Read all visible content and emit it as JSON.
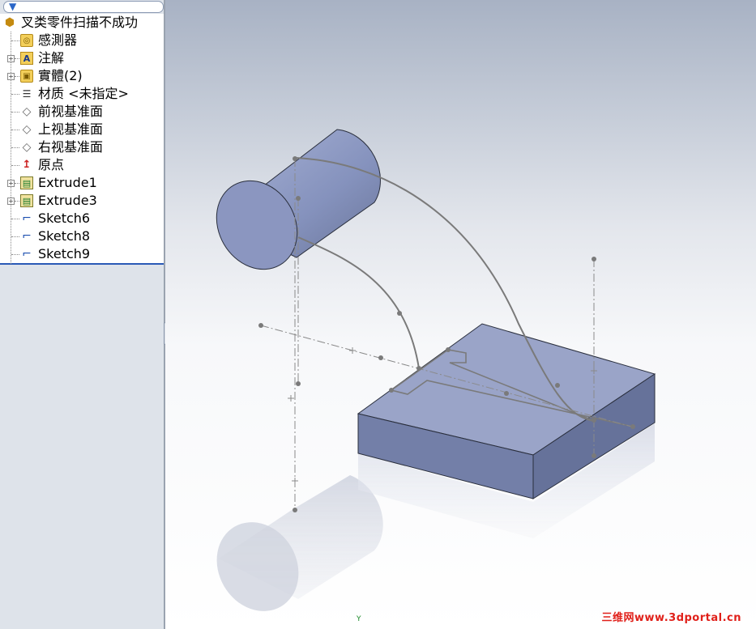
{
  "feature_tree": {
    "root_label": "叉类零件扫描不成功",
    "items": [
      {
        "label": "感測器",
        "icon": "sensor-folder-icon",
        "expandable": false
      },
      {
        "label": "注解",
        "icon": "annotations-icon",
        "expandable": true
      },
      {
        "label": "實體(2)",
        "icon": "solid-bodies-icon",
        "expandable": true
      },
      {
        "label": "材质 <未指定>",
        "icon": "material-icon",
        "expandable": false
      },
      {
        "label": "前视基准面",
        "icon": "plane-icon",
        "expandable": false
      },
      {
        "label": "上视基准面",
        "icon": "plane-icon",
        "expandable": false
      },
      {
        "label": "右视基准面",
        "icon": "plane-icon",
        "expandable": false
      },
      {
        "label": "原点",
        "icon": "origin-icon",
        "expandable": false
      },
      {
        "label": "Extrude1",
        "icon": "extrude-icon",
        "expandable": true
      },
      {
        "label": "Extrude3",
        "icon": "extrude-icon",
        "expandable": true
      },
      {
        "label": "Sketch6",
        "icon": "sketch-icon",
        "expandable": false
      },
      {
        "label": "Sketch8",
        "icon": "sketch-icon",
        "expandable": false
      },
      {
        "label": "Sketch9",
        "icon": "sketch-icon",
        "expandable": false
      }
    ]
  },
  "viewport": {
    "watermark": "三维网www.3dportal.cn",
    "triad_label": "Y",
    "part_color": "#8f9bc2",
    "background_top": "#a8b2c4"
  },
  "colors": {
    "accent": "#2a5ab6",
    "watermark": "#e0201a"
  }
}
